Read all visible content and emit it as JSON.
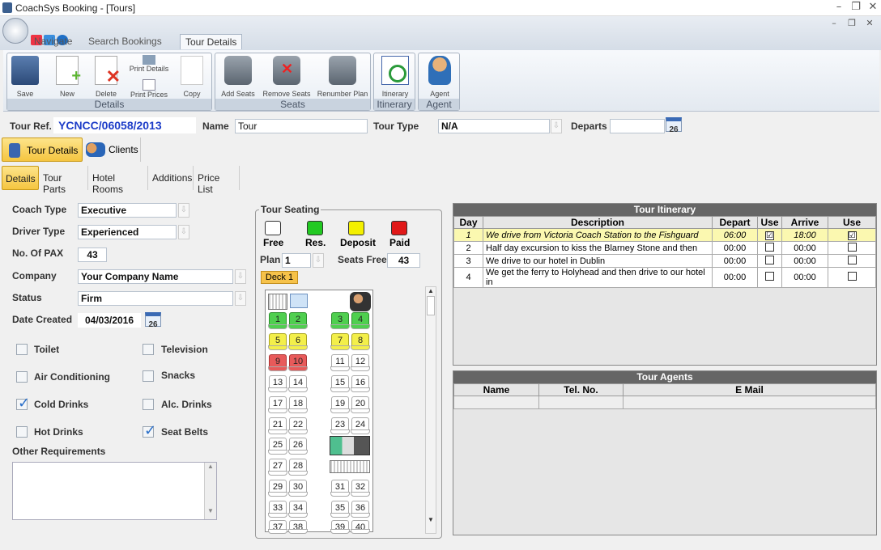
{
  "window": {
    "title": "CoachSys Booking - [Tours]"
  },
  "menu": {
    "tabs": [
      "Navigate",
      "Search Bookings",
      "Tour Details"
    ]
  },
  "ribbon": {
    "groups": {
      "details": "Details",
      "seats": "Seats",
      "itinerary": "Itinerary",
      "agent": "Agent"
    },
    "buttons": {
      "save": "Save",
      "new": "New",
      "delete": "Delete",
      "print_details": "Print Details",
      "print_prices": "Print Prices",
      "copy": "Copy",
      "add_seats": "Add Seats",
      "remove_seats": "Remove Seats",
      "renumber_plan": "Renumber Plan",
      "itinerary": "Itinerary",
      "agent": "Agent"
    }
  },
  "header": {
    "tour_ref_label": "Tour Ref.",
    "tour_ref": "YCNCC/06058/2013",
    "name_label": "Name",
    "name": "Tour",
    "tour_type_label": "Tour Type",
    "tour_type": "N/A",
    "departs_label": "Departs",
    "departs": ""
  },
  "main_tabs": {
    "tour_details": "Tour Details",
    "clients": "Clients"
  },
  "sub_tabs": [
    "Details",
    "Tour Parts",
    "Hotel Rooms",
    "Additions",
    "Price List"
  ],
  "form": {
    "coach_type_label": "Coach Type",
    "coach_type": "Executive",
    "driver_type_label": "Driver Type",
    "driver_type": "Experienced",
    "pax_label": "No. Of PAX",
    "pax": "43",
    "company_label": "Company",
    "company": "Your Company Name",
    "status_label": "Status",
    "status": "Firm",
    "date_created_label": "Date Created",
    "date_created": "04/03/2016",
    "calendar_day": "26",
    "other_req_label": "Other Requirements",
    "other_req": ""
  },
  "amenities": [
    {
      "label": "Toilet",
      "checked": false
    },
    {
      "label": "Television",
      "checked": false
    },
    {
      "label": "Air Conditioning",
      "checked": false
    },
    {
      "label": "Snacks",
      "checked": false
    },
    {
      "label": "Cold Drinks",
      "checked": true
    },
    {
      "label": "Alc. Drinks",
      "checked": false
    },
    {
      "label": "Hot Drinks",
      "checked": false
    },
    {
      "label": "Seat Belts",
      "checked": true
    }
  ],
  "seating": {
    "title": "Tour Seating",
    "legend": {
      "free": "Free",
      "res": "Res.",
      "deposit": "Deposit",
      "paid": "Paid"
    },
    "plan_label": "Plan",
    "plan": "1",
    "seats_free_label": "Seats Free",
    "seats_free": "43",
    "deck": "Deck 1",
    "colors": {
      "free": "#ffffff",
      "res": "#4fcf4f",
      "deposit": "#f3ef4a",
      "paid": "#e85a5a"
    }
  },
  "seats": {
    "s1": "1",
    "s2": "2",
    "s3": "3",
    "s4": "4",
    "s5": "5",
    "s6": "6",
    "s7": "7",
    "s8": "8",
    "s9": "9",
    "s10": "10",
    "s11": "11",
    "s12": "12",
    "s13": "13",
    "s14": "14",
    "s15": "15",
    "s16": "16",
    "s17": "17",
    "s18": "18",
    "s19": "19",
    "s20": "20",
    "s21": "21",
    "s22": "22",
    "s23": "23",
    "s24": "24",
    "s25": "25",
    "s26": "26",
    "s27": "27",
    "s28": "28",
    "s29": "29",
    "s30": "30",
    "s31": "31",
    "s32": "32",
    "s33": "33",
    "s34": "34",
    "s35": "35",
    "s36": "36",
    "s37": "37",
    "s38": "38",
    "s39": "39",
    "s40": "40"
  },
  "itinerary": {
    "title": "Tour Itinerary",
    "columns": [
      "Day",
      "Description",
      "Depart",
      "Use",
      "Arrive",
      "Use"
    ],
    "rows": [
      {
        "day": "1",
        "desc": "We drive from Victoria Coach Station to the Fishguard",
        "depart": "06:00",
        "use1": "☑",
        "arrive": "18:00",
        "use2": "☑"
      },
      {
        "day": "2",
        "desc": "Half day excursion to kiss the Blarney  Stone and then",
        "depart": "00:00",
        "use1": "",
        "arrive": "00:00",
        "use2": ""
      },
      {
        "day": "3",
        "desc": "We drive to our hotel in Dublin",
        "depart": "00:00",
        "use1": "",
        "arrive": "00:00",
        "use2": ""
      },
      {
        "day": "4",
        "desc": "We get the ferry to Holyhead and then drive to our hotel in",
        "depart": "00:00",
        "use1": "",
        "arrive": "00:00",
        "use2": ""
      }
    ]
  },
  "agents": {
    "title": "Tour Agents",
    "columns": [
      "Name",
      "Tel. No.",
      "E Mail"
    ]
  }
}
